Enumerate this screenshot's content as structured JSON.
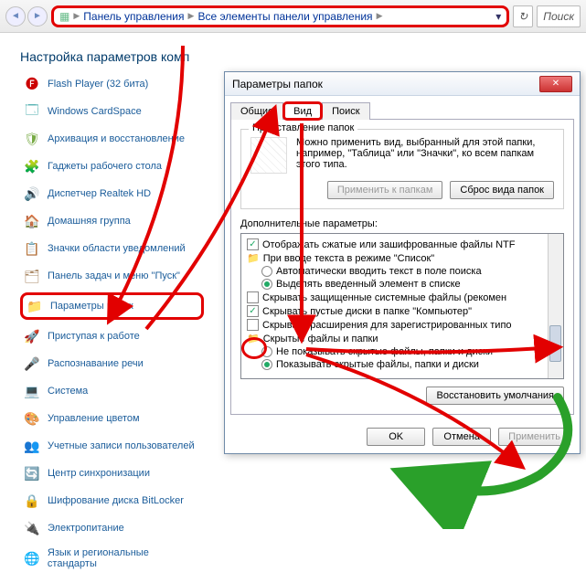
{
  "breadcrumb": {
    "root": "Панель управления",
    "sub": "Все элементы панели управления",
    "search_placeholder": "Поиск"
  },
  "page_title": "Настройка параметров комп",
  "items": [
    {
      "icon": "🅕",
      "iconColor": "#c00",
      "label": "Flash Player (32 бита)"
    },
    {
      "icon": "🗔",
      "iconColor": "#4aa",
      "label": "Windows CardSpace"
    },
    {
      "icon": "🛡",
      "iconColor": "#7a4",
      "label": "Архивация и восстановление"
    },
    {
      "icon": "🧩",
      "iconColor": "#59e",
      "label": "Гаджеты рабочего стола"
    },
    {
      "icon": "🔊",
      "iconColor": "#888",
      "label": "Диспетчер Realtek HD"
    },
    {
      "icon": "🏠",
      "iconColor": "#8b6",
      "label": "Домашняя группа"
    },
    {
      "icon": "📋",
      "iconColor": "#48c",
      "label": "Значки области уведомлений"
    },
    {
      "icon": "🗂",
      "iconColor": "#a86",
      "label": "Панель задач и меню \"Пуск\""
    },
    {
      "icon": "📁",
      "iconColor": "#e7a23c",
      "label": "Параметры папок",
      "hl": true
    },
    {
      "icon": "🚀",
      "iconColor": "#e55",
      "label": "Приступая к работе"
    },
    {
      "icon": "🎤",
      "iconColor": "#6cc",
      "label": "Распознавание речи"
    },
    {
      "icon": "💻",
      "iconColor": "#69c",
      "label": "Система"
    },
    {
      "icon": "🎨",
      "iconColor": "#e7a23c",
      "label": "Управление цветом"
    },
    {
      "icon": "👥",
      "iconColor": "#7b5",
      "label": "Учетные записи пользователей"
    },
    {
      "icon": "🔄",
      "iconColor": "#6a5",
      "label": "Центр синхронизации"
    },
    {
      "icon": "🔒",
      "iconColor": "#888",
      "label": "Шифрование диска BitLocker"
    },
    {
      "icon": "🔌",
      "iconColor": "#7b5",
      "label": "Электропитание"
    },
    {
      "icon": "🌐",
      "iconColor": "#5ad",
      "label": "Язык и региональные стандарты"
    }
  ],
  "dialog": {
    "title": "Параметры папок",
    "tabs": {
      "general": "Общие",
      "view": "Вид",
      "search": "Поиск"
    },
    "folder_view": {
      "legend": "Представление папок",
      "desc": "Можно применить вид, выбранный для этой папки, например, \"Таблица\" или \"Значки\", ко всем папкам этого типа.",
      "apply_btn": "Применить к папкам",
      "reset_btn": "Сброс вида папок"
    },
    "advanced_label": "Дополнительные параметры:",
    "advanced": [
      {
        "kind": "chk",
        "on": true,
        "label": "Отображать сжатые или зашифрованные файлы NTF",
        "indent": 0
      },
      {
        "kind": "folder",
        "label": "При вводе текста в режиме \"Список\"",
        "indent": 0
      },
      {
        "kind": "radio",
        "on": false,
        "label": "Автоматически вводить текст в поле поиска",
        "indent": 1
      },
      {
        "kind": "radio",
        "on": true,
        "label": "Выделять введенный элемент в списке",
        "indent": 1
      },
      {
        "kind": "chk",
        "on": false,
        "label": "Скрывать защищенные системные файлы (рекомен",
        "indent": 0
      },
      {
        "kind": "chk",
        "on": true,
        "label": "Скрывать пустые диски в папке \"Компьютер\"",
        "indent": 0
      },
      {
        "kind": "chk",
        "on": false,
        "label": "Скрывать расширения для зарегистрированных типо",
        "indent": 0,
        "circle": true
      },
      {
        "kind": "folder",
        "label": "Скрытые файлы и папки",
        "indent": 0
      },
      {
        "kind": "radio",
        "on": false,
        "label": "Не показывать скрытые файлы, папки и диски",
        "indent": 1
      },
      {
        "kind": "radio",
        "on": true,
        "label": "Показывать скрытые файлы, папки и диски",
        "indent": 1
      }
    ],
    "restore_btn": "Восстановить умолчания",
    "ok": "OK",
    "cancel": "Отмена",
    "apply": "Применить"
  }
}
